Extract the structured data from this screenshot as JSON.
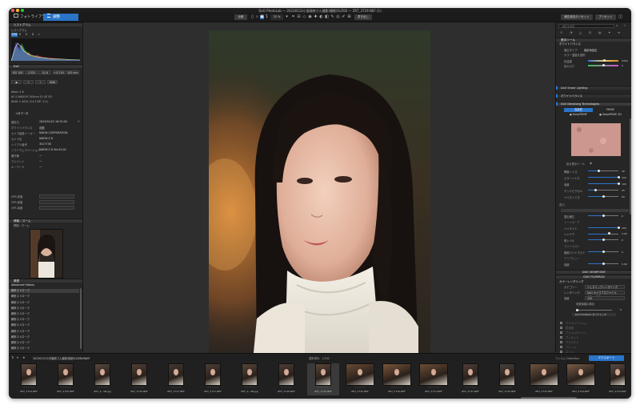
{
  "window": {
    "title": "DxO PhotoLab — 20230122小島瑠奈さん撮影/撮影01/Z6II — Z6T_3729.NEF (1)"
  },
  "toolbar": {
    "tab_library": "フォトライブラリ",
    "tab_customize": "調整",
    "compare_label": "比較",
    "zoom_value": "32 %",
    "export_label": "書き出し",
    "reset_label": "補正設定のリセット",
    "preset_label": "プリセット"
  },
  "left_panel": {
    "histogram_title": "ヒストグラム",
    "histogram_sub": "ヒストグラム",
    "channels": [
      "RGB",
      "R",
      "G",
      "B",
      "L"
    ],
    "exif_title": "Exif",
    "exif_row1": [
      "ISO 100",
      "1/320",
      "f/1.8",
      "+0.3 EV",
      "105 mm"
    ],
    "camera": "Nikon Z 6",
    "lens": "AF-S NIKKOR 105mm f/1.4E ED",
    "size": "6048 × 4024 (24.3 MP, 3:2)",
    "meta_tab": "メタデータ",
    "meta_rows": [
      {
        "k": "撮影日",
        "v": "2023/01/22 16:52:00"
      },
      {
        "k": "ホワイトバランス",
        "v": "自動"
      },
      {
        "k": "カメラ製造メーカー",
        "v": "NIKON CORPORATION"
      },
      {
        "k": "カメラ名",
        "v": "NIKON Z 6"
      },
      {
        "k": "シリアル番号",
        "v": "3017738"
      },
      {
        "k": "ソフトウェアバージョン",
        "v": "NIKON Z 6 Ver.03.00"
      },
      {
        "k": "著作権",
        "v": "—"
      },
      {
        "k": "クレジット",
        "v": "—"
      },
      {
        "k": "キーワード",
        "v": "—"
      }
    ],
    "gps_rows": [
      "GPS 緯度",
      "GPS 経度",
      "GPS 高度"
    ],
    "navigator_title": "移動／ズーム",
    "navigator_sub": "移動／ズーム",
    "history_title": "履歴",
    "history_items": [
      "Advanced History",
      "解析ストローク",
      "解析ストローク",
      "解析ストローク",
      "解析ストローク",
      "解析ストローク",
      "解析ストローク",
      "解析ストローク",
      "解析ストローク",
      "解析ストローク",
      "解析ストローク",
      "解析ストローク"
    ]
  },
  "right_panel": {
    "search_placeholder": "補正を検索",
    "section_basic": "基本ツール",
    "white_balance": "ホワイトバランス",
    "wb_type_label": "補正タイプ",
    "wb_type_value": "撮影時設定",
    "wb_label": "カラー温度を選択",
    "wb_sliders": [
      {
        "label": "色温度",
        "value": "5450",
        "pos": 0.55
      },
      {
        "label": "色かぶり",
        "value": "0",
        "pos": 0.5
      }
    ],
    "prime_tools": [
      "DxO Smart Lighting",
      "ホワイトバランス",
      "DxO Denoising Technologies"
    ],
    "denoise_modes": [
      "高品質",
      "PRIME",
      "DeepPRIME",
      "DeepPRIME XD"
    ],
    "denoise_preview": "拡大表示ツール",
    "denoise_sliders": [
      {
        "label": "輝度ノイズ",
        "value": "40",
        "pos": 0.35
      },
      {
        "label": "カラーノイズ",
        "value": "100",
        "pos": 1.0
      },
      {
        "label": "強度",
        "value": "100",
        "pos": 1.0
      },
      {
        "label": "デッドピクセル",
        "value": "25",
        "pos": 0.25
      },
      {
        "label": "メイズノイズ",
        "value": "50",
        "pos": 0.5
      }
    ],
    "tone_section": "露出",
    "tone_rows": [
      {
        "label": "露出補正",
        "value": "0",
        "pos": 0.5
      },
      {
        "label": "トーンカーブ",
        "value": "",
        "pos": 0
      },
      {
        "label": "ハイライト",
        "value": "100",
        "pos": 1.0
      },
      {
        "label": "シャドウ",
        "value": "3.00",
        "pos": 0.7
      },
      {
        "label": "黒レベル",
        "value": "0",
        "pos": 0.5
      },
      {
        "label": "コントラスト",
        "value": "",
        "pos": 0
      },
      {
        "label": "微細コントラスト",
        "value": "0",
        "pos": 0.5
      },
      {
        "label": "クリアビュー",
        "value": "",
        "pos": 0
      },
      {
        "label": "強度",
        "value": "0.00",
        "pos": 0.5
      }
    ],
    "section_viewpoint": "DXO VIEWPOINT",
    "section_filmpack": "DXO FILMPACK",
    "filmpack_sub": "カラーレンダリング",
    "render_rows": [
      {
        "label": "カテゴリー",
        "value": "ジェネリックレンダリング"
      },
      {
        "label": "レンダリング",
        "value": "DxO カメラプロファイル (Nikon Z 6)"
      },
      {
        "label": "強度",
        "value": "100"
      }
    ],
    "protect_label": "彩度保護の検出",
    "protect_value": "0",
    "filmpack_label": "DxO FilmPack ダイナミック",
    "disabled_rows": [
      "ワイルドフィルム",
      "粒状感",
      "フィルムグレイン",
      "ヴィネット",
      "テクスチャ",
      "フレーム",
      "エッジ"
    ]
  },
  "filmstrip": {
    "folder": "20230122小島瑠奈さん撮影/撮影01/Z6II/NAM",
    "selected": "選択済み：1/342",
    "current": "Z6T_3729.NEF",
    "filmpack_link": "フィルム Collection",
    "export_button": "エクスポート",
    "thumbs": [
      {
        "name": "Z6T_3724.NEF",
        "tone": "#5d4a40"
      },
      {
        "name": "Z6T_3725.NEF",
        "tone": "#4a3c34"
      },
      {
        "name": "Z6T_3...SB.jpg",
        "tone": "#594a3f"
      },
      {
        "name": "Z6T_3726.NEF",
        "tone": "#514036"
      },
      {
        "name": "Z6T_3727.NEF",
        "tone": "#3f3733"
      },
      {
        "name": "Z6T_3727.NEF",
        "tone": "#4c3e36"
      },
      {
        "name": "Z6T_3...SB.jpg",
        "tone": "#574538"
      },
      {
        "name": "Z6T_3728.NEF",
        "tone": "#4d3d34"
      },
      {
        "name": "Z6T_3729.NEF",
        "tone": "#5c4638"
      },
      {
        "name": "Z6T_3730.NEF",
        "tone": "#6a4a34"
      },
      {
        "name": "Z6T_3730.NEF",
        "tone": "#7a5538"
      },
      {
        "name": "Z6T_3731.NEF",
        "tone": "#6e4d36"
      },
      {
        "name": "Z6T_3731.NEF",
        "tone": "#4e3e36"
      },
      {
        "name": "Z6T_3732.NEF",
        "tone": "#48403a"
      },
      {
        "name": "Z6T_3733.NEF",
        "tone": "#6d5440"
      },
      {
        "name": "Z6T_3734.NEF",
        "tone": "#7a5c46"
      },
      {
        "name": "Z6T_3734.NEF",
        "tone": "#5a4a40"
      }
    ]
  },
  "colors": {
    "accent": "#2a74c9",
    "panel": "#262626",
    "header": "#343434"
  }
}
